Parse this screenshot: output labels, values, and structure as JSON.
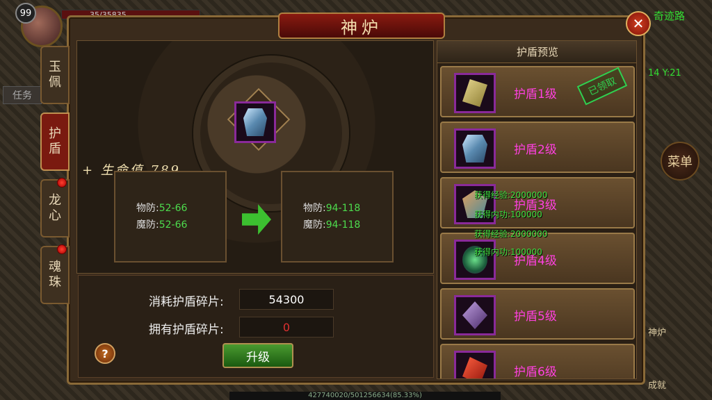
{
  "hud": {
    "level": "99",
    "hp_text": "35/35835",
    "task_label": "任务",
    "map_name": "奇迹路",
    "coord": "14 Y:21",
    "menu_label": "菜单",
    "furnace_label": "神炉",
    "achievement_label": "成就",
    "exp_text": "427740020/501256634(85.33%)"
  },
  "window": {
    "title": "神炉",
    "close_glyph": "✕"
  },
  "side_tabs": [
    {
      "label": "玉\n佩",
      "active": false,
      "badge": false
    },
    {
      "label": "护\n盾",
      "active": true,
      "badge": false
    },
    {
      "label": "龙\n心",
      "active": false,
      "badge": true
    },
    {
      "label": "魂\n珠",
      "active": false,
      "badge": true
    }
  ],
  "upgrade": {
    "hp_gain": "+ 生命值 789",
    "current": {
      "phys_label": "物防:",
      "phys_val": "52-66",
      "mag_label": "魔防:",
      "mag_val": "52-66"
    },
    "next": {
      "phys_label": "物防:",
      "phys_val": "94-118",
      "mag_label": "魔防:",
      "mag_val": "94-118"
    },
    "cost_label": "消耗护盾碎片:",
    "cost_value": "54300",
    "own_label": "拥有护盾碎片:",
    "own_value": "0",
    "upgrade_button": "升级",
    "help_glyph": "?"
  },
  "preview": {
    "title": "护盾预览",
    "claimed_stamp": "已领取",
    "items": [
      {
        "name": "护盾1级",
        "icon": "shield-lv1-icon"
      },
      {
        "name": "护盾2级",
        "icon": "shield-lv2-icon"
      },
      {
        "name": "护盾3级",
        "icon": "shield-lv3-icon"
      },
      {
        "name": "护盾4级",
        "icon": "shield-lv4-icon"
      },
      {
        "name": "护盾5级",
        "icon": "shield-lv5-icon"
      },
      {
        "name": "护盾6级",
        "icon": "shield-lv6-icon"
      }
    ]
  },
  "float_texts": [
    "获得经验:2000000",
    "获得内功:100000",
    "获得经验:2000000",
    "获得内功:100000"
  ],
  "colors": {
    "stat_value": "#4ddc4d",
    "item_name": "#ff40e0",
    "own_value": "#e03030"
  }
}
